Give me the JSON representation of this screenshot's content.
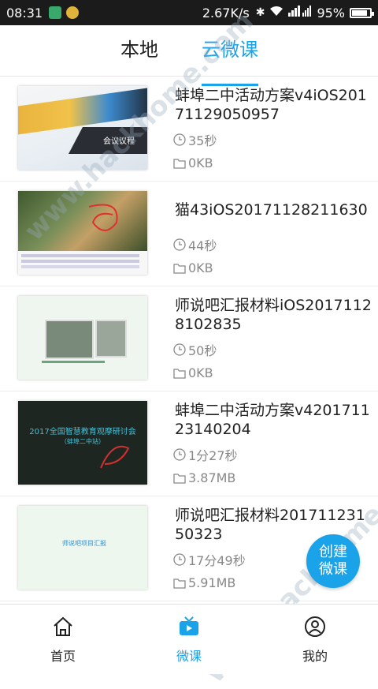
{
  "status_bar": {
    "time": "08:31",
    "speed": "2.67K/s",
    "battery": "95%",
    "battery_level": 0.95,
    "network_label": "4G"
  },
  "tabs": [
    {
      "label": "本地",
      "active": false
    },
    {
      "label": "云微课",
      "active": true
    }
  ],
  "colors": {
    "accent": "#1aa3e8"
  },
  "items": [
    {
      "title": "蚌埠二中活动方案v4iOS20171129050957",
      "duration": "35秒",
      "size": "0KB",
      "thumb_text": "会议议程"
    },
    {
      "title": "猫43iOS20171128211630",
      "duration": "44秒",
      "size": "0KB"
    },
    {
      "title": "师说吧汇报材料iOS20171128102835",
      "duration": "50秒",
      "size": "0KB"
    },
    {
      "title": "蚌埠二中活动方案v420171123140204",
      "duration": "1分27秒",
      "size": "3.87MB",
      "thumb_text": "2017全国智慧教育观摩研讨会",
      "thumb_sub": "（蚌埠二中站）"
    },
    {
      "title": "师说吧汇报材料20171123150323",
      "duration": "17分49秒",
      "size": "5.91MB",
      "thumb_text": "师说吧项目汇报"
    }
  ],
  "fab": {
    "line1": "创建",
    "line2": "微课"
  },
  "bottom_nav": [
    {
      "label": "首页",
      "icon": "home-icon",
      "active": false
    },
    {
      "label": "微课",
      "icon": "tv-icon",
      "active": true
    },
    {
      "label": "我的",
      "icon": "person-icon",
      "active": false
    }
  ],
  "watermark": "www.hackhome.com"
}
